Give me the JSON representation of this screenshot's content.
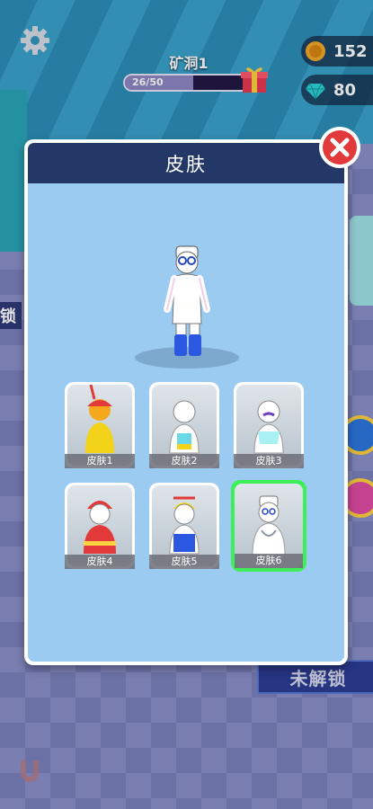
{
  "hud": {
    "level_title": "矿洞1",
    "progress_text": "26/50",
    "progress_fraction": 0.52,
    "coins": "152",
    "gems": "80"
  },
  "background": {
    "left_lock_text": "锁",
    "locked_button": "未解锁"
  },
  "dialog": {
    "title": "皮肤",
    "skins": [
      {
        "label": "皮肤1"
      },
      {
        "label": "皮肤2"
      },
      {
        "label": "皮肤3"
      },
      {
        "label": "皮肤4"
      },
      {
        "label": "皮肤5"
      },
      {
        "label": "皮肤6"
      }
    ],
    "selected_skin": "皮肤6"
  },
  "colors": {
    "header": "#233866",
    "panel": "#9ccbf1",
    "selected_border": "#3df05a",
    "close": "#e23a3a"
  }
}
